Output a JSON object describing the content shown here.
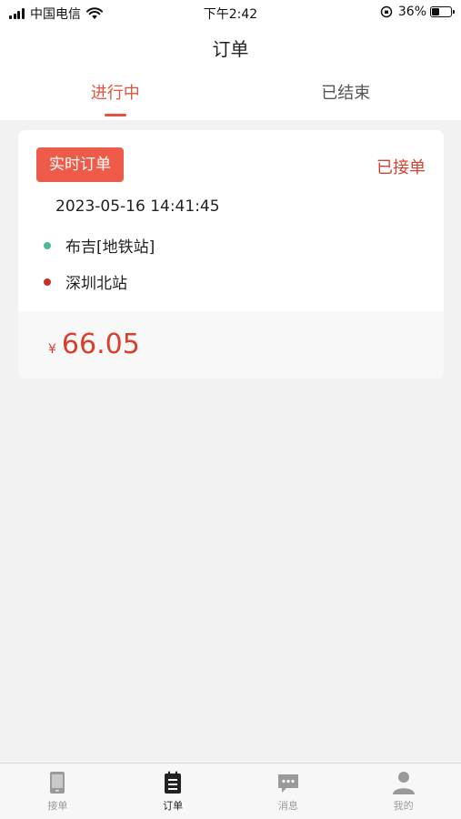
{
  "status_bar": {
    "carrier": "中国电信",
    "time": "下午2:42",
    "battery": "36%",
    "battery_level": 0.36
  },
  "nav": {
    "title": "订单"
  },
  "tabs": [
    {
      "label": "进行中",
      "active": true
    },
    {
      "label": "已结束",
      "active": false
    }
  ],
  "order": {
    "type_label": "实时订单",
    "status": "已接单",
    "time": "2023-05-16 14:41:45",
    "from": "布吉[地铁站]",
    "to": "深圳北站",
    "currency": "¥",
    "amount": "66.05"
  },
  "colors": {
    "accent": "#e0543d",
    "from_dot": "#4dbb8f",
    "to_dot": "#c8302a"
  },
  "tabbar": [
    {
      "label": "接单",
      "icon": "phone-icon",
      "active": false
    },
    {
      "label": "订单",
      "icon": "list-icon",
      "active": true
    },
    {
      "label": "消息",
      "icon": "message-icon",
      "active": false
    },
    {
      "label": "我的",
      "icon": "person-icon",
      "active": false
    }
  ]
}
